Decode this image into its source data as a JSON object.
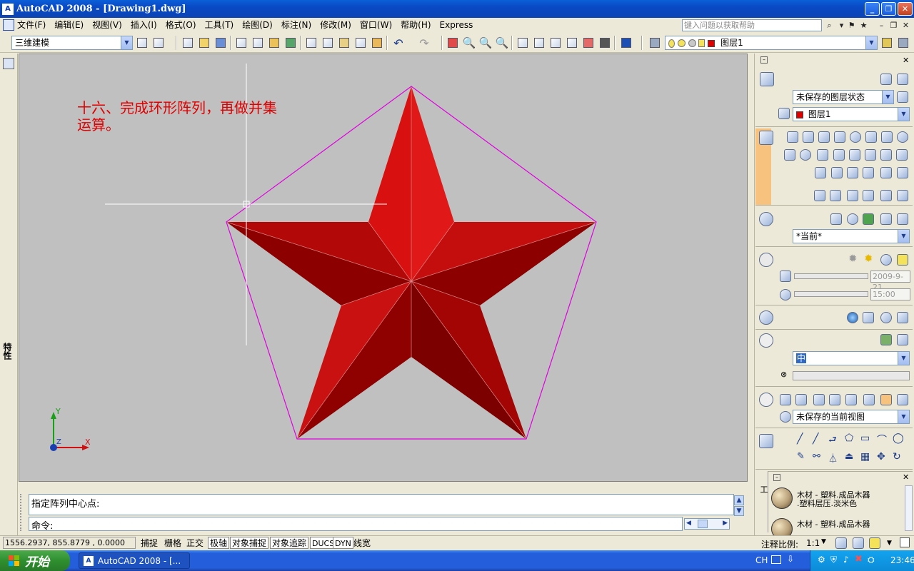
{
  "window": {
    "title": "AutoCAD 2008 - [Drawing1.dwg]",
    "app_icon": "A"
  },
  "menu": {
    "items": [
      "文件(F)",
      "编辑(E)",
      "视图(V)",
      "插入(I)",
      "格式(O)",
      "工具(T)",
      "绘图(D)",
      "标注(N)",
      "修改(M)",
      "窗口(W)",
      "帮助(H)",
      "Express"
    ],
    "help_search_placeholder": "键入问题以获取帮助"
  },
  "toolbar": {
    "workspace": "三维建模",
    "layer": "图层1"
  },
  "left_strip": {
    "label": "特性"
  },
  "canvas": {
    "background": "#c0c0c0",
    "note_line1": "十六、完成环形阵列，再做并集",
    "note_line2": "运算。",
    "ucs_y": "Y",
    "ucs_x": "X",
    "ucs_z": "Z",
    "star_color_light": "#e21313",
    "star_color_dark": "#8c0000",
    "pentagon_color": "#e000e0"
  },
  "command": {
    "history": "指定阵列中心点:",
    "prompt": "命令:"
  },
  "status": {
    "coords": "1556.2937, 855.8779 , 0.0000",
    "toggles": [
      {
        "label": "捕捉",
        "on": false
      },
      {
        "label": "栅格",
        "on": false
      },
      {
        "label": "正交",
        "on": false
      },
      {
        "label": "极轴",
        "on": true
      },
      {
        "label": "对象捕捉",
        "on": true
      },
      {
        "label": "对象追踪",
        "on": true
      },
      {
        "label": "DUCS",
        "on": true
      },
      {
        "label": "DYN",
        "on": true
      },
      {
        "label": "线宽",
        "on": false
      }
    ],
    "annotation_scale_label": "注释比例:",
    "annotation_scale": "1:1"
  },
  "panel": {
    "layer_state": "未保存的图层状态",
    "layer": "图层1",
    "visual_style": "*当前*",
    "date": "2009-9-21",
    "time": "15:00",
    "light_preset": "中",
    "view": "未保存的当前视图",
    "materials": [
      {
        "line1": "木材 - 塑料.成品木器",
        "line2": ".塑料层压.淡米色"
      },
      {
        "line1": "木材 - 塑料.成品木器",
        "line2": ""
      }
    ],
    "material_tab": "工"
  },
  "taskbar": {
    "start": "开始",
    "task": "AutoCAD 2008 - [...",
    "lang": "CH",
    "clock": "23:46"
  }
}
